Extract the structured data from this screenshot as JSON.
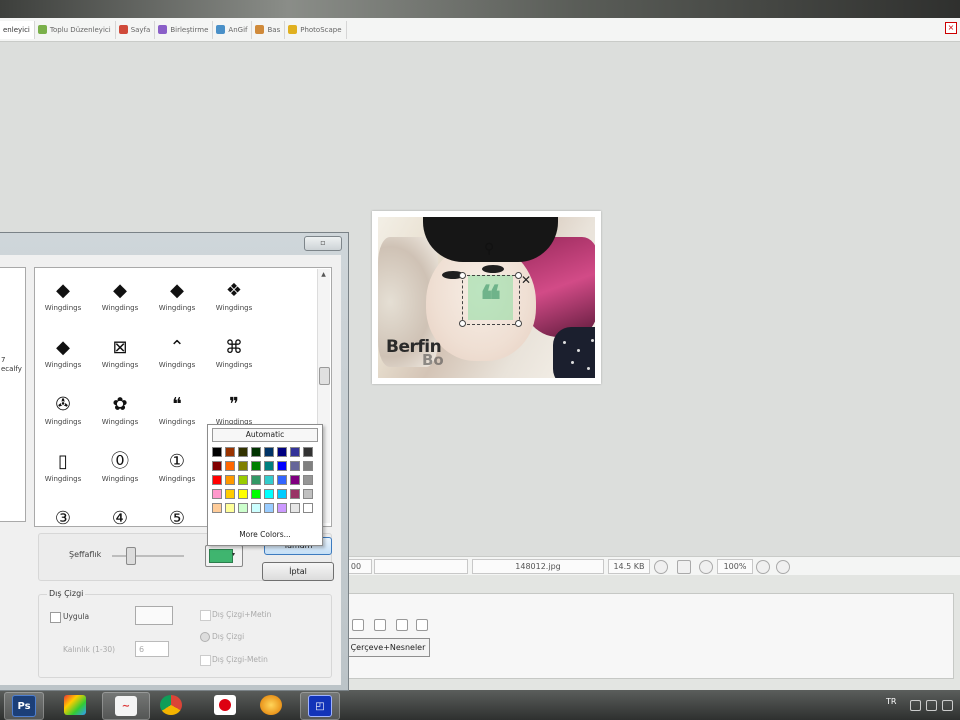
{
  "tabs": [
    {
      "label": "enleyici",
      "color": "#5a8fd8"
    },
    {
      "label": "Toplu Düzenleyici",
      "color": "#7ab04a"
    },
    {
      "label": "Sayfa",
      "color": "#d04a3a"
    },
    {
      "label": "Birleştirme",
      "color": "#8a5fc8"
    },
    {
      "label": "AnGif",
      "color": "#4a90c8"
    },
    {
      "label": "Bas",
      "color": "#d08a3a"
    },
    {
      "label": "PhotoScape",
      "color": "#e0b020"
    }
  ],
  "photo": {
    "signature": "Berfin",
    "signature_ghost": "Bo"
  },
  "status": {
    "zoom_left": "00",
    "filename": "148012.jpg",
    "filesize": "14.5 KB",
    "zoom": "100%"
  },
  "dialog": {
    "left_list": [
      "7",
      "ecalfy"
    ],
    "symbols": [
      {
        "glyph": "◆",
        "font": "Wingdings"
      },
      {
        "glyph": "◆",
        "font": "Wingdings"
      },
      {
        "glyph": "◆",
        "font": "Wingdings"
      },
      {
        "glyph": "❖",
        "font": "Wingdings"
      },
      {
        "glyph": "◆",
        "font": "Wingdings"
      },
      {
        "glyph": "⊠",
        "font": "Wingdings"
      },
      {
        "glyph": "⌃",
        "font": "Wingdings"
      },
      {
        "glyph": "⌘",
        "font": "Wingdings"
      },
      {
        "glyph": "✇",
        "font": "Wingdings"
      },
      {
        "glyph": "✿",
        "font": "Wingdings"
      },
      {
        "glyph": "❝",
        "font": "Wingdings"
      },
      {
        "glyph": "❞",
        "font": "Wingdings"
      },
      {
        "glyph": "▯",
        "font": "Wingdings"
      },
      {
        "glyph": "⓪",
        "font": "Wingdings"
      },
      {
        "glyph": "①",
        "font": "Wingdings"
      },
      {
        "glyph": "",
        "font": ""
      },
      {
        "glyph": "③",
        "font": ""
      },
      {
        "glyph": "④",
        "font": ""
      },
      {
        "glyph": "⑤",
        "font": ""
      },
      {
        "glyph": "",
        "font": ""
      }
    ],
    "color_popup": {
      "automatic": "Automatic",
      "more_colors": "More Colors...",
      "swatches": [
        "#000000",
        "#993300",
        "#333300",
        "#003300",
        "#003366",
        "#000080",
        "#333399",
        "#333333",
        "#800000",
        "#ff6600",
        "#808000",
        "#008000",
        "#008080",
        "#0000ff",
        "#666699",
        "#808080",
        "#ff0000",
        "#ff9900",
        "#99cc00",
        "#339966",
        "#33cccc",
        "#3366ff",
        "#800080",
        "#969696",
        "#ff99cc",
        "#ffcc00",
        "#ffff00",
        "#00ff00",
        "#00ffff",
        "#00ccff",
        "#993366",
        "#c0c0c0",
        "#ffcc99",
        "#ffff99",
        "#ccffcc",
        "#ccffff",
        "#99ccff",
        "#cc99ff",
        "#e6e6e6",
        "#ffffff"
      ]
    },
    "opacity_label": "Şeffaflık",
    "selected_color": "#3fb56f",
    "ok_label": "Tamam",
    "cancel_label": "İptal",
    "outline": {
      "title": "Dış Çizgi",
      "apply_label": "Uygula",
      "thickness_label": "Kalınlık (1-30)",
      "thickness_value": "6",
      "options": [
        "Dış Çizgi+Metin",
        "Dış Çizgi",
        "Dış Çizgi-Metin"
      ]
    }
  },
  "lower_panel": {
    "frame_button": "Çerçeve+Nesneler"
  },
  "tray": {
    "lang": "TR"
  }
}
